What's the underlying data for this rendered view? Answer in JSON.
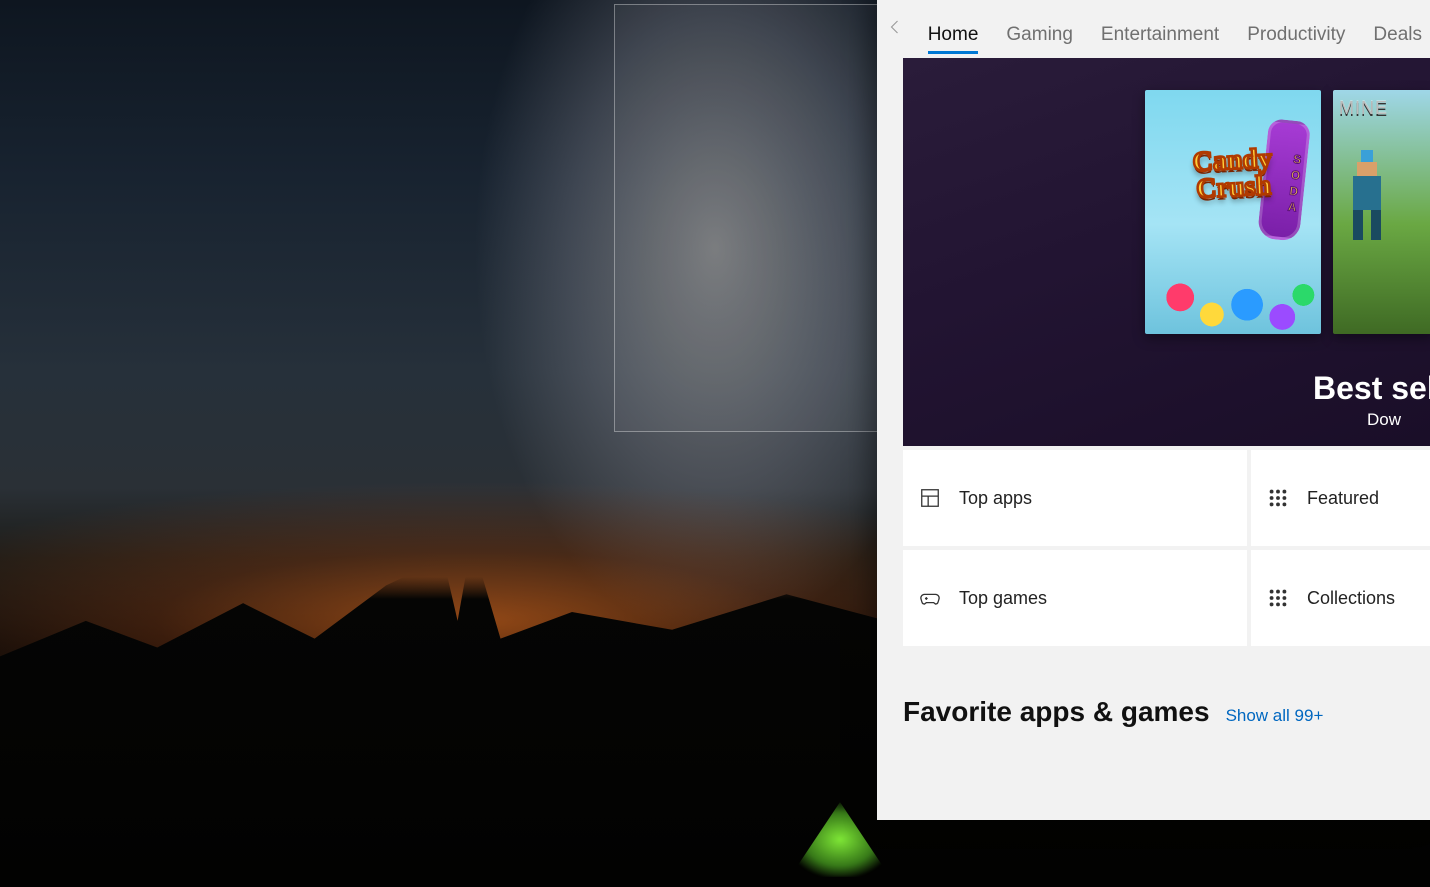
{
  "nav": {
    "tabs": [
      "Home",
      "Gaming",
      "Entertainment",
      "Productivity",
      "Deals"
    ],
    "active_index": 0
  },
  "hero": {
    "title": "Best sel",
    "subtitle": "Dow",
    "tiles": [
      {
        "name": "Candy Crush Soda Saga",
        "logo_line1": "Candy",
        "logo_line2": "Crush"
      },
      {
        "name": "Minecraft",
        "logo_partial": "MINE"
      }
    ]
  },
  "categories": [
    {
      "icon": "layout",
      "label": "Top apps"
    },
    {
      "icon": "grid",
      "label": "Featured"
    },
    {
      "icon": "gamepad",
      "label": "Top games"
    },
    {
      "icon": "grid",
      "label": "Collections"
    }
  ],
  "favorites": {
    "title": "Favorite apps & games",
    "show_all": "Show all 99+"
  }
}
